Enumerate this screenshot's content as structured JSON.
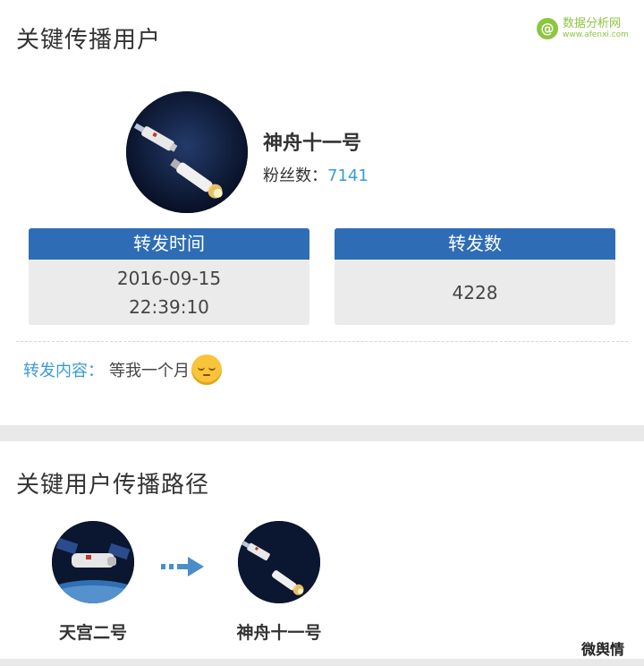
{
  "key_user_section": {
    "title": "关键传播用户",
    "user": {
      "name": "神舟十一号",
      "followers_label": "粉丝数：",
      "followers_count": "7141"
    },
    "stats": [
      {
        "label": "转发时间",
        "value_date": "2016-09-15",
        "value_time": "22:39:10"
      },
      {
        "label": "转发数",
        "value": "4228"
      }
    ],
    "content_label": "转发内容：",
    "content_text": "等我一个月",
    "emoji_icon": "relieved-face-emoji"
  },
  "logo": {
    "badge": "@",
    "text_cn": "数据分析网",
    "text_en": "www.afenxi.com"
  },
  "path_section": {
    "title": "关键用户传播路径",
    "nodes": [
      {
        "name": "天宫二号"
      },
      {
        "name": "神舟十一号"
      }
    ],
    "arrow_icon": "arrow-right-icon"
  },
  "watermark": "微舆情",
  "colors": {
    "accent_blue": "#2e6db5",
    "link_blue": "#3a9ad9",
    "logo_green": "#8cc63f",
    "card_bg": "#ebebeb"
  }
}
